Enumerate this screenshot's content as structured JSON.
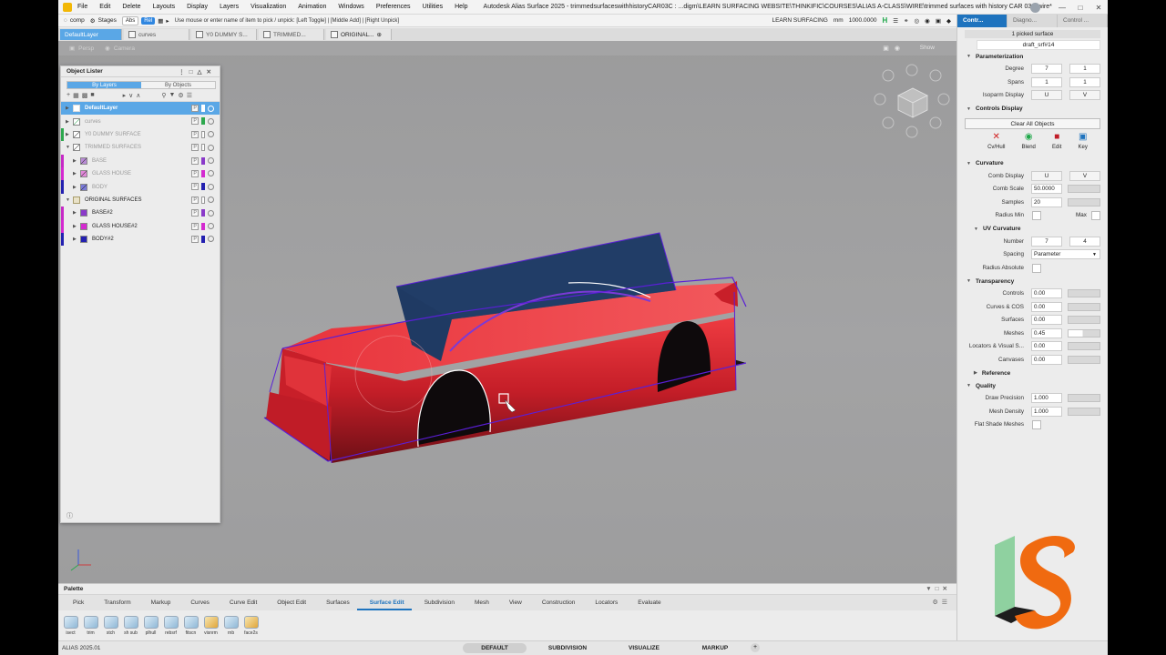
{
  "app": {
    "menu": [
      "File",
      "Edit",
      "Delete",
      "Layouts",
      "Display",
      "Layers",
      "Visualization",
      "Animation",
      "Windows",
      "Preferences",
      "Utilities",
      "Help"
    ],
    "title": "Autodesk Alias Surface 2025   - trimmedsurfaceswithhistoryCAR03C : ...digm\\LEARN SURFACING WEBSITE\\THINKIFIC\\COURSES\\ALIAS A-CLASS\\WIRE\\trimmed surfaces with history  CAR 03C.wire*"
  },
  "toolbar": {
    "comp": "comp",
    "stages": "Stages",
    "abs": "Abs",
    "rel": "Rel",
    "hint": "Use mouse or enter name of item to pick / unpick: [Left Toggle] | [Middle Add] | [Right Unpick]",
    "project": "LEARN SURFACING",
    "units": "mm",
    "value": "1000.0000",
    "h_label": "H"
  },
  "layer_tabs": [
    "DefaultLayer",
    "curves",
    "Y0 DUMMY S...",
    "TRIMMED...",
    "ORIGINAL..."
  ],
  "viewport": {
    "persp": "Persp",
    "camera": "Camera",
    "show": "Show"
  },
  "lister": {
    "title": "Object Lister",
    "by_layers": "By Layers",
    "by_objects": "By Objects",
    "rows": [
      {
        "label": "DefaultLayer",
        "sym": "P"
      },
      {
        "label": "curves",
        "sym": "P"
      },
      {
        "label": "Y0 DUMMY SURFACE",
        "sym": "P"
      },
      {
        "label": "TRIMMED SURFACES",
        "sym": "P"
      },
      {
        "label": "BASE",
        "sym": "P"
      },
      {
        "label": "GLASS HOUSE",
        "sym": "P"
      },
      {
        "label": "BODY",
        "sym": "P"
      },
      {
        "label": "ORIGINAL SURFACES",
        "sym": "P"
      },
      {
        "label": "BASE#2",
        "sym": "P"
      },
      {
        "label": "GLASS HOUSE#2",
        "sym": "P"
      },
      {
        "label": "BODY#2",
        "sym": "P"
      }
    ]
  },
  "panel": {
    "tabs": [
      "Contr...",
      "Diagno...",
      "Control ..."
    ],
    "picked": "1 picked surface",
    "surface_name": "draft_srf#14",
    "parameterization": {
      "title": "Parameterization",
      "degree_label": "Degree",
      "degree_u": "7",
      "degree_v": "1",
      "spans_label": "Spans",
      "spans_u": "1",
      "spans_v": "1",
      "isoparm_label": "Isoparm Display",
      "isoparm_u": "U",
      "isoparm_v": "V"
    },
    "controls_display": {
      "title": "Controls Display",
      "clear": "Clear All Objects",
      "cvhull": "Cv/Hull",
      "blend": "Blend",
      "edit": "Edit",
      "key": "Key"
    },
    "curvature": {
      "title": "Curvature",
      "comb_display_label": "Comb Display",
      "comb_u": "U",
      "comb_v": "V",
      "comb_scale_label": "Comb Scale",
      "comb_scale": "50.0000",
      "samples_label": "Samples",
      "samples": "20",
      "radius_min_label": "Radius Min",
      "max_label": "Max"
    },
    "uv_curvature": {
      "title": "UV Curvature",
      "number_label": "Number",
      "number_u": "7",
      "number_v": "4",
      "spacing_label": "Spacing",
      "spacing": "Parameter",
      "radius_abs_label": "Radius Absolute"
    },
    "transparency": {
      "title": "Transparency",
      "controls_label": "Controls",
      "controls": "0.00",
      "curves_label": "Curves & COS",
      "curves": "0.00",
      "surfaces_label": "Surfaces",
      "surfaces": "0.00",
      "meshes_label": "Meshes",
      "meshes": "0.45",
      "locators_label": "Locators & Visual S...",
      "locators": "0.00",
      "canvases_label": "Canvases",
      "canvases": "0.00"
    },
    "reference": {
      "title": "Reference"
    },
    "quality": {
      "title": "Quality",
      "draw_label": "Draw Precision",
      "draw": "1.000",
      "mesh_label": "Mesh Density",
      "mesh": "1.000",
      "flat_label": "Flat Shade Meshes"
    }
  },
  "palette": {
    "title": "Palette",
    "tabs": [
      "Pick",
      "Transform",
      "Markup",
      "Curves",
      "Curve Edit",
      "Object Edit",
      "Surfaces",
      "Surface Edit",
      "Subdivision",
      "Mesh",
      "View",
      "Construction",
      "Locators",
      "Evaluate"
    ],
    "tools": [
      "isect",
      "trim",
      "stch",
      "sh sub",
      "plhull",
      "rebsrf",
      "fitscn",
      "visnrm",
      "rnb",
      "face2s"
    ]
  },
  "status": {
    "version": "ALIAS 2025.01",
    "workspaces": [
      "DEFAULT",
      "SUBDIVISION",
      "VISUALIZE",
      "MARKUP"
    ]
  },
  "colors": {
    "accent": "#5aa7e6",
    "tab_active": "#1e73be",
    "car_body": "#d9252f",
    "glass": "#1f3a63",
    "outline": "#5a1fd6"
  }
}
